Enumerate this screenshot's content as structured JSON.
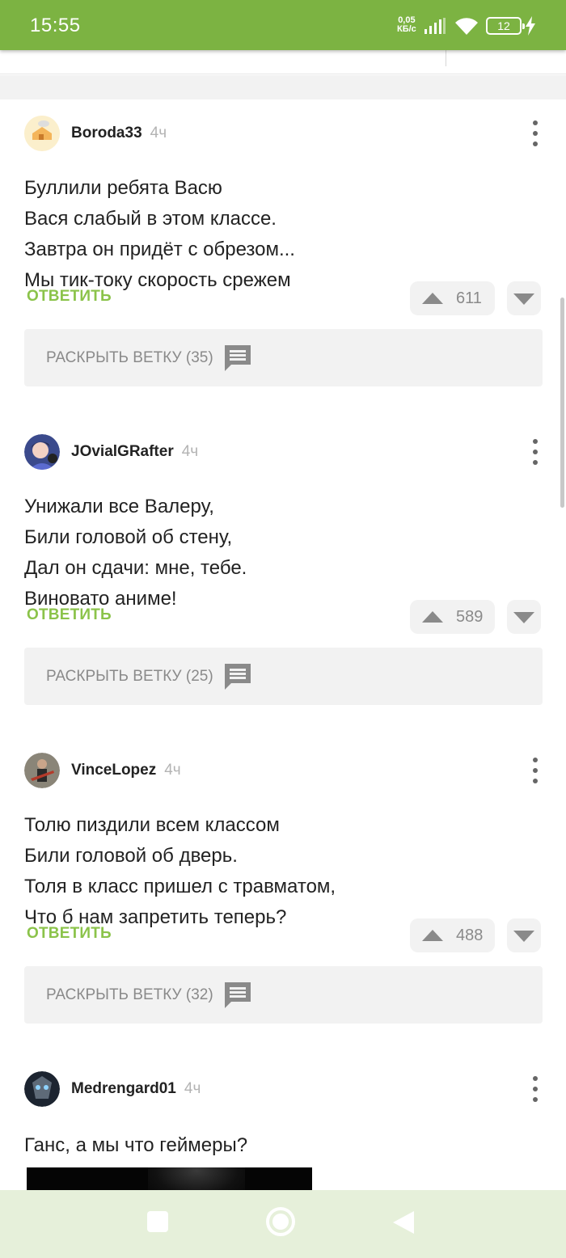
{
  "status_bar": {
    "time": "15:55",
    "speed_value": "0,05",
    "speed_unit": "КБ/с",
    "battery": "12",
    "bg_color": "#7cb342"
  },
  "comments": [
    {
      "author": "Boroda33",
      "time_ago": "4ч",
      "avatar_icon": "cheese-house-avatar",
      "lines": [
        "Буллили ребята Васю",
        "Вася слабый в этом классе.",
        "Завтра он придёт с обрезом...",
        "Мы тик-току скорость срежем"
      ],
      "reply_label": "ОТВЕТИТЬ",
      "rating": "611",
      "expand_label": "РАСКРЫТЬ ВЕТКУ (35)"
    },
    {
      "author": "JOvialGRafter",
      "time_ago": "4ч",
      "avatar_icon": "anime-character-avatar",
      "lines": [
        "Унижали все Валеру,",
        "Били головой об стену,",
        "Дал он сдачи: мне, тебе.",
        "Виновато аниме!"
      ],
      "reply_label": "ОТВЕТИТЬ",
      "rating": "589",
      "expand_label": "РАСКРЫТЬ ВЕТКУ (25)"
    },
    {
      "author": "VinceLopez",
      "time_ago": "4ч",
      "avatar_icon": "guitarist-avatar",
      "lines": [
        "Толю пиздили всем классом",
        "Били головой об дверь.",
        "Толя в класс пришел с травматом,",
        "Что б нам запретить теперь?"
      ],
      "reply_label": "ОТВЕТИТЬ",
      "rating": "488",
      "expand_label": "РАСКРЫТЬ ВЕТКУ (32)"
    },
    {
      "author": "Medrengard01",
      "time_ago": "4ч",
      "avatar_icon": "robot-avatar",
      "lines": [
        "Ганс, а мы что геймеры?"
      ]
    }
  ],
  "colors": {
    "accent_green": "#8bc34a",
    "nav_bg": "#e6f0da"
  }
}
